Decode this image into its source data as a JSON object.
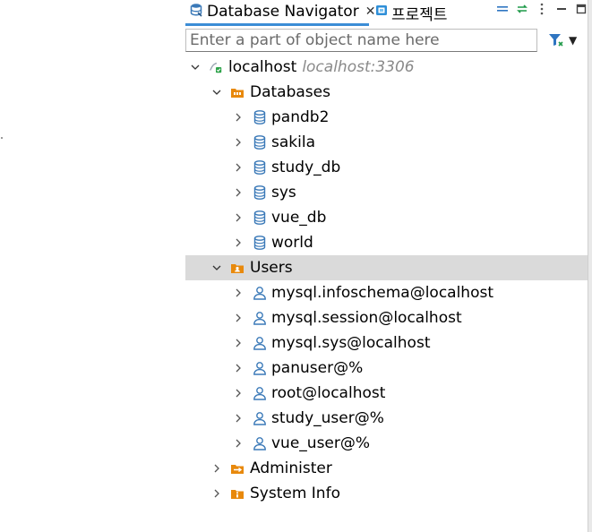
{
  "tabs": {
    "navigator_label": "Database Navigator",
    "project_label": "프로젝트"
  },
  "search": {
    "placeholder": "Enter a part of object name here"
  },
  "tree": {
    "connection": {
      "name": "localhost",
      "detail": "localhost:3306"
    },
    "databases": {
      "label": "Databases",
      "items": [
        "pandb2",
        "sakila",
        "study_db",
        "sys",
        "vue_db",
        "world"
      ]
    },
    "users": {
      "label": "Users",
      "items": [
        "mysql.infoschema@localhost",
        "mysql.session@localhost",
        "mysql.sys@localhost",
        "panuser@%",
        "root@localhost",
        "study_user@%",
        "vue_user@%"
      ]
    },
    "administer": {
      "label": "Administer"
    },
    "system_info": {
      "label": "System Info"
    }
  },
  "colors": {
    "accent": "#3c8dd6",
    "folder_orange": "#e8890c",
    "db_blue": "#3a79b8",
    "user_blue": "#3a79b8",
    "selection": "#dadada"
  }
}
